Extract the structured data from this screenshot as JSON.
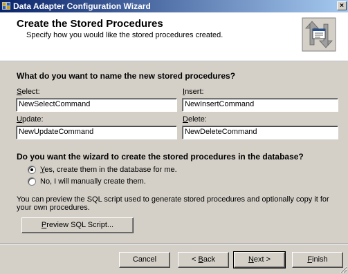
{
  "window": {
    "title": "Data Adapter Configuration Wizard",
    "close_glyph": "×"
  },
  "header": {
    "title": "Create the Stored Procedures",
    "subtitle": "Specify how you would like the stored procedures created.",
    "icon": "stored-procedure-wizard-icon"
  },
  "naming": {
    "question": "What do you want to name the new stored procedures?",
    "select": {
      "label_key": "S",
      "label_rest": "elect:",
      "value": "NewSelectCommand"
    },
    "insert": {
      "label_key": "I",
      "label_rest": "nsert:",
      "value": "NewInsertCommand"
    },
    "update": {
      "label_key": "U",
      "label_rest": "pdate:",
      "value": "NewUpdateCommand"
    },
    "delete": {
      "label_key": "D",
      "label_rest": "elete:",
      "value": "NewDeleteCommand"
    }
  },
  "create": {
    "question": "Do you want the wizard to create the stored procedures in the database?",
    "option_yes": {
      "key": "Y",
      "rest": "es, create them in the database for me.",
      "selected": true
    },
    "option_no": {
      "text": "No, I will manually create them.",
      "selected": false
    }
  },
  "preview": {
    "info": "You can preview the SQL script used to generate stored procedures and optionally copy it for your own procedures.",
    "button_key": "P",
    "button_rest": "review SQL Script..."
  },
  "buttons": {
    "cancel": "Cancel",
    "back_prefix": "< ",
    "back_key": "B",
    "back_rest": "ack",
    "next_key": "N",
    "next_rest": "ext >",
    "finish_key": "F",
    "finish_rest": "inish"
  },
  "colors": {
    "face": "#d4d0c8",
    "titlebar_start": "#0a246a",
    "titlebar_end": "#a6caf0"
  }
}
